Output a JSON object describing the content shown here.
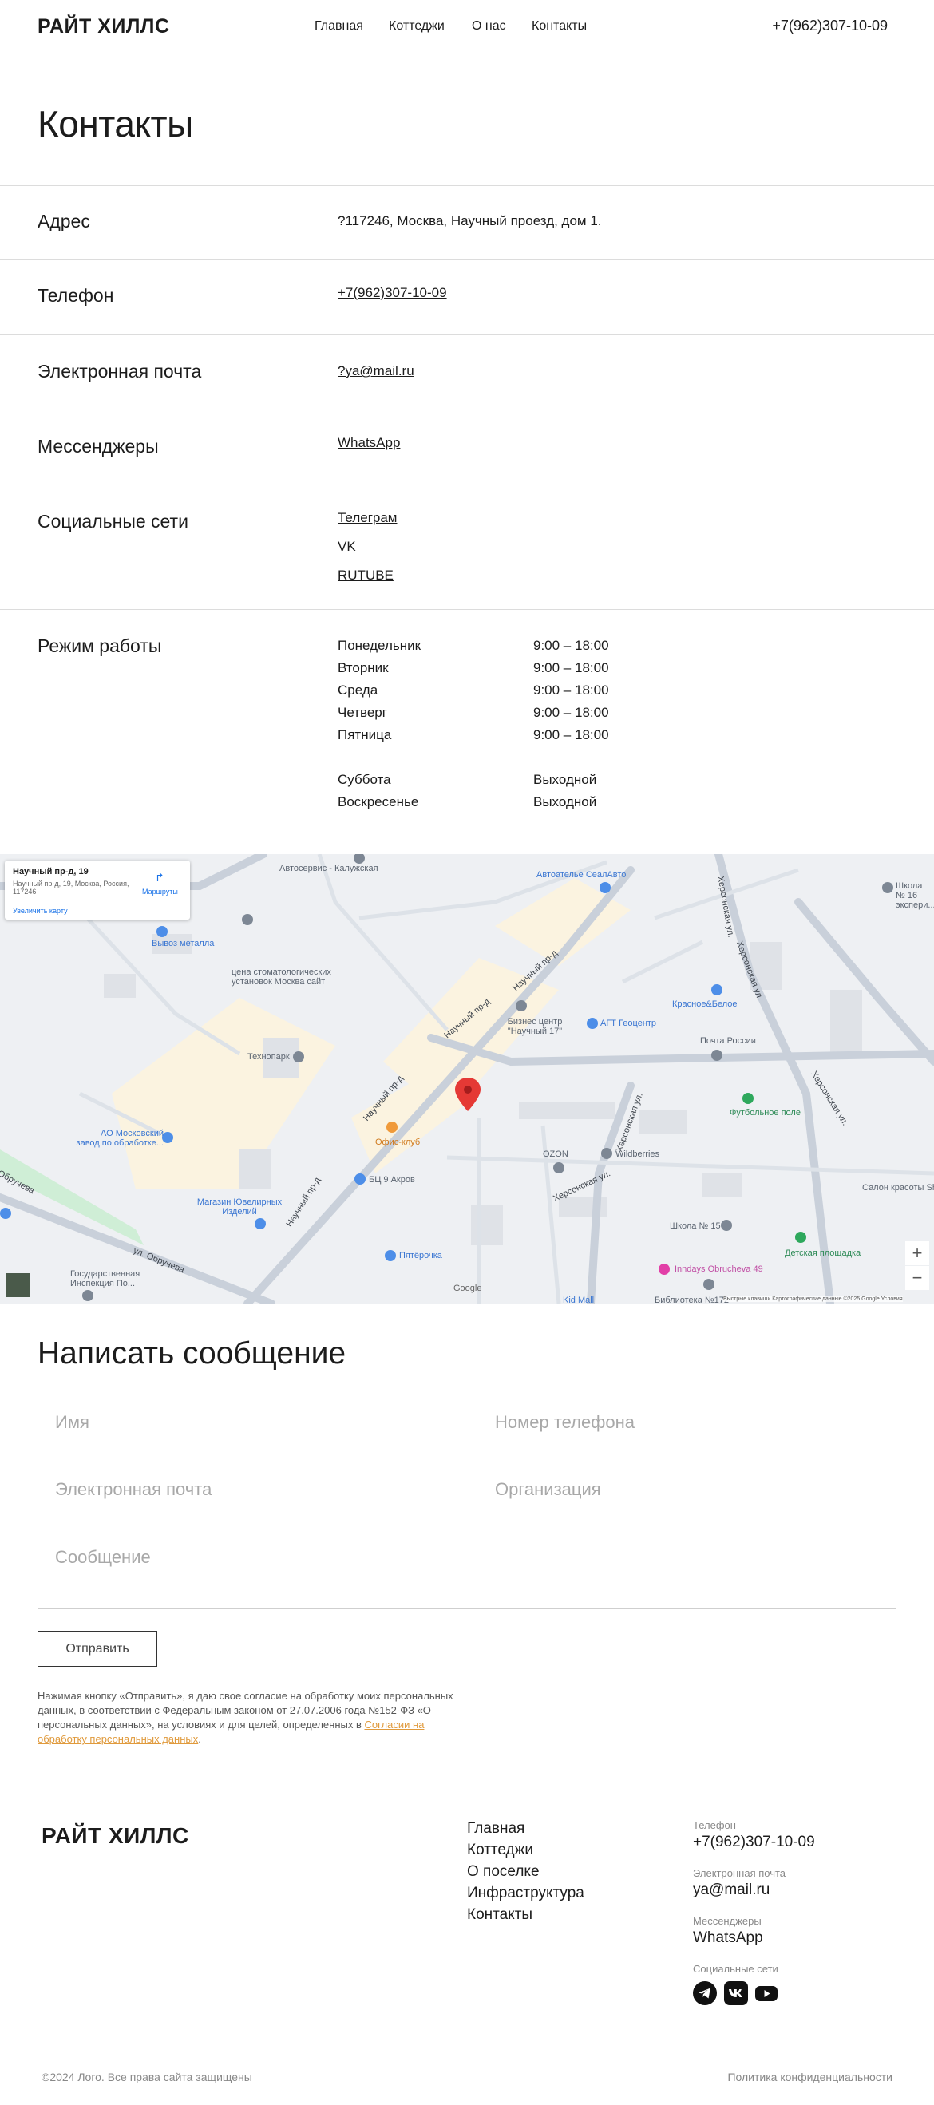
{
  "header": {
    "logo": "РАЙТ ХИЛЛС",
    "nav": [
      "Главная",
      "Коттеджи",
      "О нас",
      "Контакты"
    ],
    "phone": "+7(962)307-10-09"
  },
  "page_title": "Контакты",
  "contacts": {
    "address_label": "Адрес",
    "address_value": "?117246, Москва, Научный проезд, дом 1.",
    "phone_label": "Телефон",
    "phone_value": "+7(962)307-10-09",
    "email_label": "Электронная почта",
    "email_value": "?ya@mail.ru",
    "messengers_label": "Мессенджеры",
    "messengers_value": "WhatsApp",
    "social_label": "Социальные сети",
    "social_links": [
      "Телеграм",
      "VK",
      "RUTUBE"
    ],
    "hours_label": "Режим работы",
    "hours": [
      {
        "day": "Понедельник",
        "time": "9:00 – 18:00"
      },
      {
        "day": "Вторник",
        "time": "9:00 – 18:00"
      },
      {
        "day": "Среда",
        "time": "9:00 – 18:00"
      },
      {
        "day": "Четверг",
        "time": "9:00 – 18:00"
      },
      {
        "day": "Пятница",
        "time": "9:00 – 18:00"
      },
      {
        "day": "Суббота",
        "time": "Выходной"
      },
      {
        "day": "Воскресенье",
        "time": "Выходной"
      }
    ]
  },
  "map": {
    "card_title": "Научный пр-д, 19",
    "card_address": "Научный пр-д, 19, Москва, Россия, 117246",
    "card_routes": "Маршруты",
    "card_enlarge": "Увеличить карту",
    "labels": {
      "l1": "Автосервис - Калужская",
      "l2": "Автоателье СеалАвто",
      "l3": "Вывоз металла",
      "l4": "цена стоматологических установок Москва сайт",
      "l5": "Технопарк",
      "l6": "Бизнес центр \"Научный 17\"",
      "l7": "АГТ Геоцентр",
      "l8": "Красное&Белое",
      "l9": "Почта России",
      "l10": "Футбольное поле",
      "l11": "АО Московский завод по обработке...",
      "l12": "Офис-клуб",
      "l13": "БЦ 9 Акров",
      "l14": "Магазин Ювелирных Изделий",
      "l15": "OZON",
      "l16": "Wildberries",
      "l17": "Салон красоты Sh",
      "l18": "Школа № 15",
      "l19": "Детская площадка",
      "l20": "Пятёрочка",
      "l21": "Inndays Obrucheva 49",
      "l22": "Государственная Инспекция По...",
      "l23": "Библиотека №172",
      "l24": "Kid Mall",
      "l25": "Школа № 16 экспери...",
      "s1": "Научный пр-д",
      "s2": "Научный пр-д",
      "s3": "Научный пр-д",
      "s4": "Научный пр-д",
      "s5": "ул. Обручева",
      "s6": "Херсонская ул.",
      "s7": "Херсонская ул.",
      "s8": "Херсонская ул.",
      "s9": "Херсонская ул.",
      "s10": "Херсонская ул.",
      "s11": "Обручева",
      "google": "Google",
      "attrib": "Быстрые клавиши   Картографические данные ©2025 Google   Условия"
    },
    "zoom_in": "+",
    "zoom_out": "−"
  },
  "form": {
    "title": "Написать сообщение",
    "name_placeholder": "Имя",
    "phone_placeholder": "Номер телефона",
    "email_placeholder": "Электронная почта",
    "org_placeholder": "Организация",
    "message_placeholder": "Сообщение",
    "submit": "Отправить",
    "consent_text": "Нажимая кнопку «Отправить», я даю свое согласие на обработку моих персональных данных, в соответствии с Федеральным законом от 27.07.2006 года №152-ФЗ «О персональных данных», на условиях и для целей, определенных в ",
    "consent_link": "Согласии на обработку персональных данных",
    "consent_end": "."
  },
  "footer": {
    "logo": "РАЙТ ХИЛЛС",
    "nav": [
      "Главная",
      "Коттеджи",
      "О поселке",
      "Инфраструктура",
      "Контакты"
    ],
    "phone_caption": "Телефон",
    "phone": "+7(962)307-10-09",
    "email_caption": "Электронная почта",
    "email": "ya@mail.ru",
    "messengers_caption": "Мессенджеры",
    "messengers": "WhatsApp",
    "social_caption": "Социальные сети",
    "social_icons": [
      "telegram-icon",
      "vk-icon",
      "youtube-icon"
    ],
    "copyright": "©2024 Лого. Все права сайта защищены",
    "policy": "Политика конфиденциальности"
  }
}
